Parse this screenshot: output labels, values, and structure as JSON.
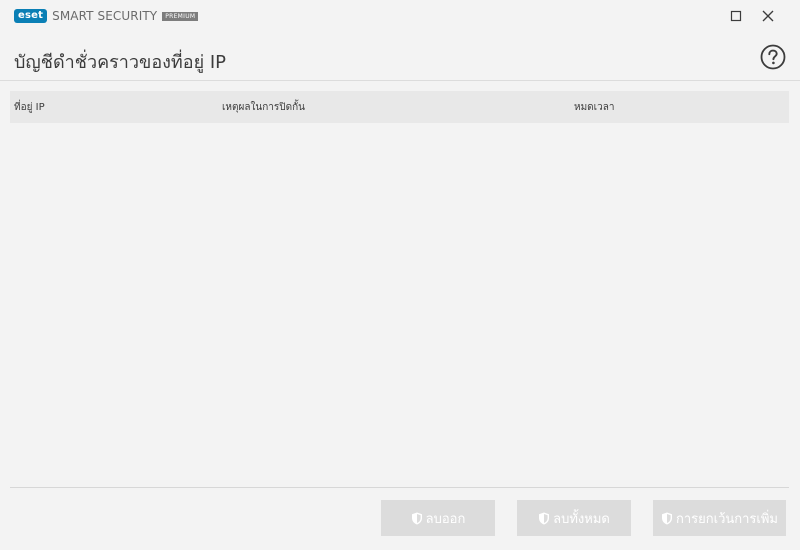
{
  "app": {
    "logo_text": "eset",
    "product_name": "SMART SECURITY",
    "edition": "PREMIUM"
  },
  "header": {
    "title": "บัญชีดำชั่วคราวของที่อยู่ IP"
  },
  "table": {
    "columns": [
      {
        "label": "ที่อยู่ IP"
      },
      {
        "label": "เหตุผลในการปิดกั้น"
      },
      {
        "label": "หมดเวลา"
      }
    ],
    "rows": []
  },
  "footer": {
    "remove_label": "ลบออก",
    "remove_all_label": "ลบทั้งหมด",
    "add_exclusion_label": "การยกเว้นการเพิ่ม"
  },
  "colors": {
    "background": "#f3f3f3",
    "brand": "#0a7fb5",
    "table_header": "#e8e8e8",
    "button_disabled": "#dcdcdc",
    "text": "#3c3c3c"
  },
  "icons": {
    "minimize_maximize": "maximize-icon",
    "close": "close-icon",
    "help": "help-icon",
    "button_icon": "shield-icon"
  }
}
